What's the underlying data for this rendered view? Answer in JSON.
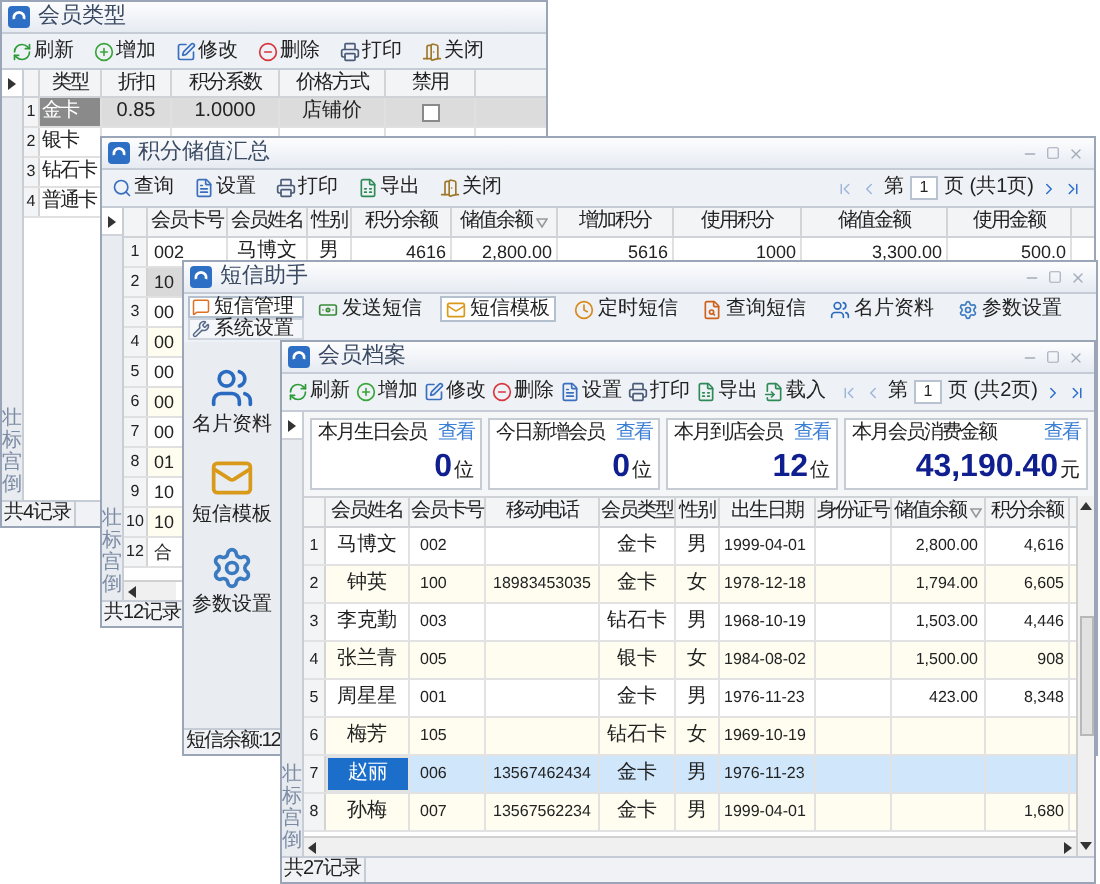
{
  "type_window": {
    "title": "会员类型",
    "toolbar": [
      {
        "label": "刷新"
      },
      {
        "label": "增加"
      },
      {
        "label": "修改"
      },
      {
        "label": "删除"
      },
      {
        "label": "打印"
      },
      {
        "label": "关闭"
      }
    ],
    "columns": [
      "类型",
      "折扣",
      "积分系数",
      "价格方式",
      "禁用"
    ],
    "rows": [
      {
        "num": "1",
        "cells": [
          "金卡",
          "0.85",
          "1.0000",
          "店铺价"
        ],
        "banned": false,
        "selected": true
      },
      {
        "num": "2",
        "cells": [
          "银卡"
        ],
        "selected": false
      },
      {
        "num": "3",
        "cells": [
          "钻石卡"
        ],
        "selected": false
      },
      {
        "num": "4",
        "cells": [
          "普通卡"
        ],
        "selected": false
      }
    ],
    "side_label": "壮标宫倒",
    "status": "共4记录"
  },
  "summary_window": {
    "title": "积分储值汇总",
    "toolbar": [
      {
        "label": "查询"
      },
      {
        "label": "设置"
      },
      {
        "label": "打印"
      },
      {
        "label": "导出"
      },
      {
        "label": "关闭"
      }
    ],
    "pager": {
      "prefix": "第",
      "page": "1",
      "suffix": "页 (共1页)"
    },
    "columns": [
      "会员卡号",
      "会员姓名",
      "性别",
      "积分余额",
      "储值余额",
      "增加积分",
      "使用积分",
      "储值金额",
      "使用金额"
    ],
    "rows": [
      {
        "num": "1",
        "cells": [
          "002",
          "马博文",
          "男",
          "4616",
          "2,800.00",
          "5616",
          "1000",
          "3,300.00",
          "500.0"
        ],
        "selected": false
      },
      {
        "num": "2",
        "cells": [
          "10"
        ],
        "selected": true
      },
      {
        "num": "3",
        "cells": [
          "00"
        ],
        "selected": false
      },
      {
        "num": "4",
        "cells": [
          "00"
        ],
        "selected": false
      },
      {
        "num": "5",
        "cells": [
          "00"
        ],
        "selected": false
      },
      {
        "num": "6",
        "cells": [
          "00"
        ],
        "selected": false
      },
      {
        "num": "7",
        "cells": [
          "00"
        ],
        "selected": false
      },
      {
        "num": "8",
        "cells": [
          "01"
        ],
        "selected": false
      },
      {
        "num": "9",
        "cells": [
          "10"
        ],
        "selected": false
      },
      {
        "num": "10",
        "cells": [
          "10"
        ],
        "selected": false
      },
      {
        "num": "12",
        "cells": [
          "合"
        ],
        "selected": false
      }
    ],
    "side_label": "壮标宫倒",
    "status": "共12记录"
  },
  "sms_window": {
    "title": "短信助手",
    "nav": [
      {
        "label": "短信管理",
        "selected": true
      },
      {
        "label": "系统设置",
        "selected": false
      }
    ],
    "tabs": [
      {
        "label": "发送短信",
        "selected": false
      },
      {
        "label": "短信模板",
        "selected": true
      },
      {
        "label": "定时短信",
        "selected": false
      },
      {
        "label": "查询短信",
        "selected": false
      },
      {
        "label": "名片资料",
        "selected": false
      },
      {
        "label": "参数设置",
        "selected": false
      }
    ],
    "panel": [
      {
        "label": "名片资料"
      },
      {
        "label": "短信模板"
      },
      {
        "label": "参数设置"
      }
    ],
    "status": "短信余额:12"
  },
  "member_window": {
    "title": "会员档案",
    "toolbar": [
      {
        "label": "刷新"
      },
      {
        "label": "增加"
      },
      {
        "label": "修改"
      },
      {
        "label": "删除"
      },
      {
        "label": "设置"
      },
      {
        "label": "打印"
      },
      {
        "label": "导出"
      },
      {
        "label": "载入"
      }
    ],
    "pager": {
      "prefix": "第",
      "page": "1",
      "suffix": "页 (共2页)"
    },
    "stats": [
      {
        "title": "本月生日会员",
        "link": "查看",
        "value": "0",
        "unit": "位"
      },
      {
        "title": "今日新增会员",
        "link": "查看",
        "value": "0",
        "unit": "位"
      },
      {
        "title": "本月到店会员",
        "link": "查看",
        "value": "12",
        "unit": "位"
      },
      {
        "title": "本月会员消费金额",
        "link": "查看",
        "value": "43,190.40",
        "unit": "元"
      }
    ],
    "columns": [
      "会员姓名",
      "会员卡号",
      "移动电话",
      "会员类型",
      "性别",
      "出生日期",
      "身份证号",
      "储值余额",
      "积分余额"
    ],
    "rows": [
      {
        "num": "1",
        "cells": [
          "马博文",
          "002",
          "",
          "金卡",
          "男",
          "1999-04-01",
          "",
          "2,800.00",
          "4,616"
        ],
        "selected": false
      },
      {
        "num": "2",
        "cells": [
          "钟英",
          "100",
          "18983453035",
          "金卡",
          "女",
          "1978-12-18",
          "",
          "1,794.00",
          "6,605"
        ],
        "selected": false
      },
      {
        "num": "3",
        "cells": [
          "李克勤",
          "003",
          "",
          "钻石卡",
          "男",
          "1968-10-19",
          "",
          "1,503.00",
          "4,446"
        ],
        "selected": false
      },
      {
        "num": "4",
        "cells": [
          "张兰青",
          "005",
          "",
          "银卡",
          "女",
          "1984-08-02",
          "",
          "1,500.00",
          "908"
        ],
        "selected": false
      },
      {
        "num": "5",
        "cells": [
          "周星星",
          "001",
          "",
          "金卡",
          "男",
          "1976-11-23",
          "",
          "423.00",
          "8,348"
        ],
        "selected": false
      },
      {
        "num": "6",
        "cells": [
          "梅芳",
          "105",
          "",
          "钻石卡",
          "女",
          "1969-10-19",
          "",
          "",
          ""
        ],
        "selected": false
      },
      {
        "num": "7",
        "cells": [
          "赵丽",
          "006",
          "13567462434",
          "金卡",
          "男",
          "1976-11-23",
          "",
          "",
          ""
        ],
        "selected": true
      },
      {
        "num": "8",
        "cells": [
          "孙梅",
          "007",
          "13567562234",
          "金卡",
          "男",
          "1999-04-01",
          "",
          "",
          "1,680"
        ],
        "selected": false
      }
    ],
    "side_label": "壮标宫倒",
    "status": "共27记录"
  }
}
